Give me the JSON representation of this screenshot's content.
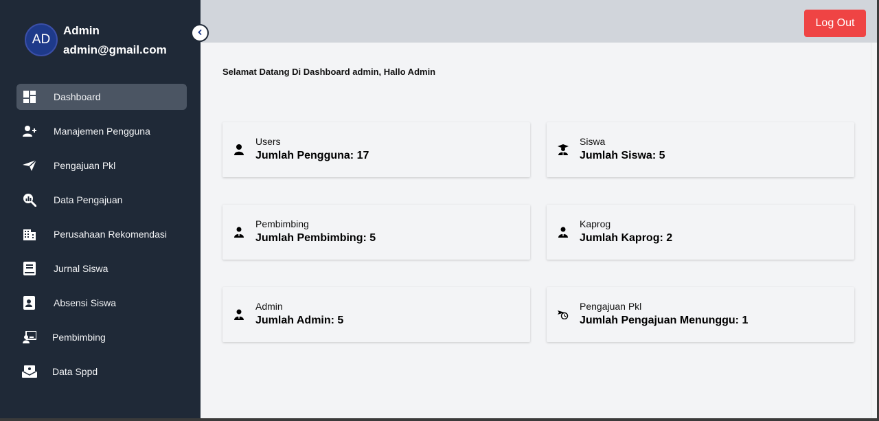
{
  "user": {
    "initials": "AD",
    "name": "Admin",
    "email": "admin@gmail.com"
  },
  "sidebar": {
    "items": [
      {
        "label": "Dashboard",
        "icon": "dashboard-icon",
        "active": true
      },
      {
        "label": "Manajemen Pengguna",
        "icon": "user-plus-icon"
      },
      {
        "label": "Pengajuan Pkl",
        "icon": "paper-plane-icon"
      },
      {
        "label": "Data Pengajuan",
        "icon": "magnify-chart-icon"
      },
      {
        "label": "Perusahaan Rekomendasi",
        "icon": "building-icon"
      },
      {
        "label": "Jurnal Siswa",
        "icon": "book-icon"
      },
      {
        "label": "Absensi Siswa",
        "icon": "contact-book-icon"
      },
      {
        "label": "Pembimbing",
        "icon": "teacher-board-icon"
      },
      {
        "label": "Data Sppd",
        "icon": "money-envelope-icon"
      }
    ]
  },
  "header": {
    "logout_label": "Log Out"
  },
  "main": {
    "welcome": "Selamat Datang Di Dashboard admin, Hallo Admin",
    "cards": [
      {
        "title": "Users",
        "value": "Jumlah Pengguna: 17",
        "icon": "user-icon"
      },
      {
        "title": "Siswa",
        "value": "Jumlah Siswa: 5",
        "icon": "graduate-icon"
      },
      {
        "title": "Pembimbing",
        "value": "Jumlah Pembimbing: 5",
        "icon": "user-tie-icon"
      },
      {
        "title": "Kaprog",
        "value": "Jumlah Kaprog: 2",
        "icon": "user-tie-icon"
      },
      {
        "title": "Admin",
        "value": "Jumlah Admin: 5",
        "icon": "user-tie-icon"
      },
      {
        "title": "Pengajuan Pkl",
        "value": "Jumlah Pengajuan Menunggu: 1",
        "icon": "hourglass-send-icon"
      }
    ]
  },
  "colors": {
    "sidebar_bg": "#1f2937",
    "active_item": "#4b5563",
    "logout": "#ef4444",
    "topbar": "#d1d5db",
    "content_bg": "#f3f4f6"
  }
}
